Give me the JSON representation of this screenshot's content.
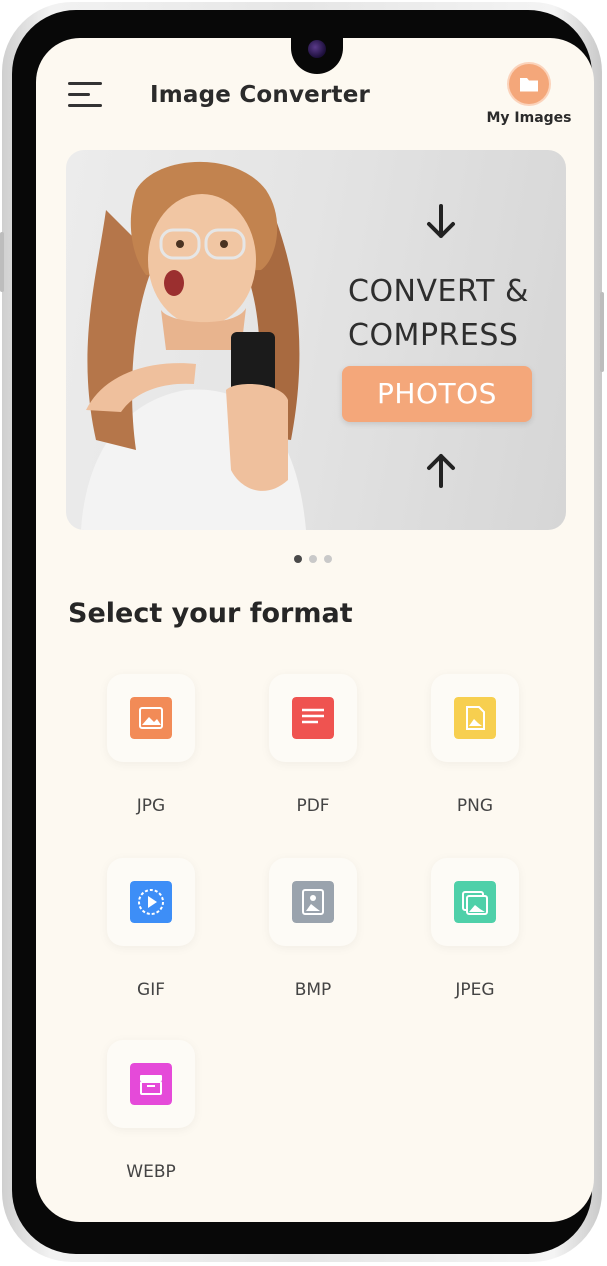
{
  "header": {
    "title": "Image Converter",
    "my_images_label": "My Images"
  },
  "banner": {
    "line1": "CONVERT &",
    "line2": "COMPRESS",
    "button": "PHOTOS",
    "slide_count": 3,
    "active_slide": 1
  },
  "section": {
    "title": "Select your format"
  },
  "formats": [
    {
      "label": "JPG",
      "color": "#f28b57"
    },
    {
      "label": "PDF",
      "color": "#ef5350"
    },
    {
      "label": "PNG",
      "color": "#f7cf4f"
    },
    {
      "label": "GIF",
      "color": "#3d8ef7"
    },
    {
      "label": "BMP",
      "color": "#9aa3ad"
    },
    {
      "label": "JPEG",
      "color": "#4fd0a9"
    },
    {
      "label": "WEBP",
      "color": "#e54ad9"
    }
  ],
  "colors": {
    "accent": "#f4a77a",
    "screen_bg": "#fdf9f1"
  }
}
